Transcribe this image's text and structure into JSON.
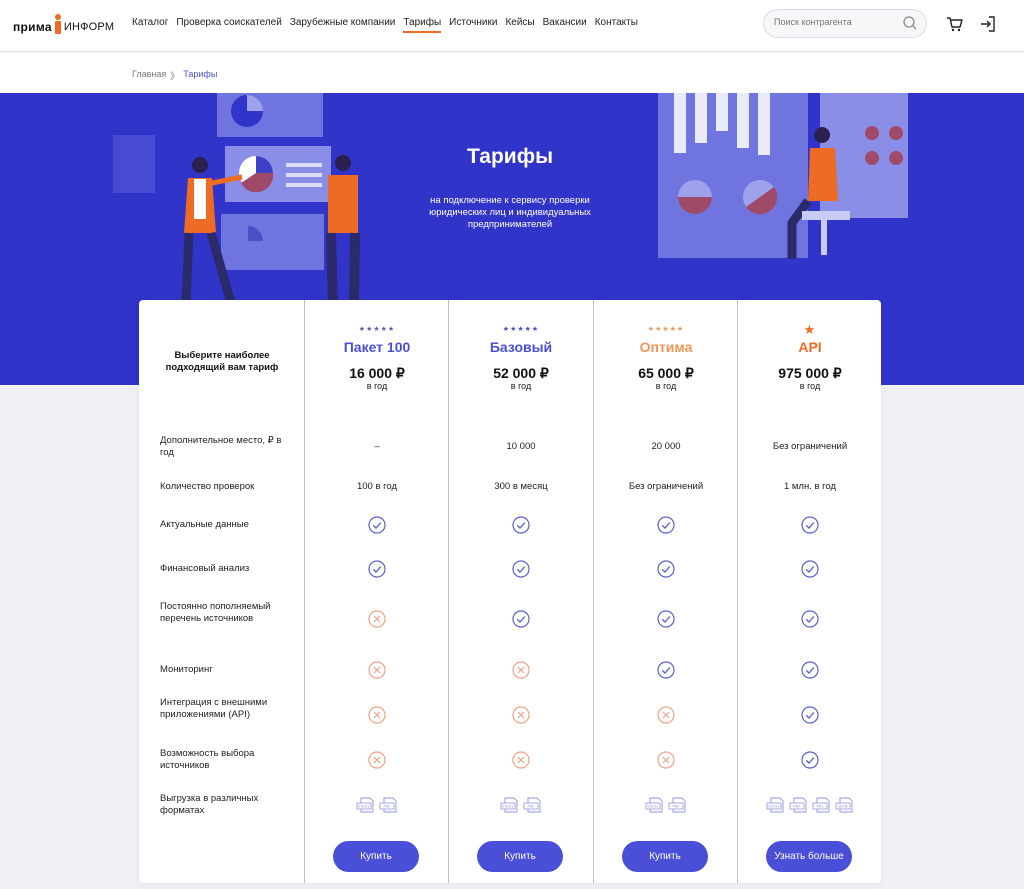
{
  "header": {
    "logo_bold": "прима",
    "logo_light": "ИНФОРМ",
    "nav": [
      "Каталог",
      "Проверка соискателей",
      "Зарубежные компании",
      "Тарифы",
      "Источники",
      "Кейсы",
      "Вакансии",
      "Контакты"
    ],
    "search_placeholder": "Поиск контрагента"
  },
  "breadcrumb": {
    "home": "Главная",
    "sep": "》",
    "current": "Тарифы"
  },
  "hero": {
    "title": "Тарифы",
    "subtitle": "на подключение к сервису проверки юридических лиц и индивидуальных предпринимателей"
  },
  "pricing": {
    "choose_label": "Выберите наиболее подходящий вам тариф",
    "plans": [
      {
        "stars": "★★★★★",
        "name": "Пакет 100",
        "price": "16 000 ₽",
        "period": "в год",
        "name_color": "#4a4fd8",
        "star_color": "#5a5fb0",
        "button": "Купить"
      },
      {
        "stars": "★★★★★",
        "name": "Базовый",
        "price": "52 000 ₽",
        "period": "в год",
        "name_color": "#4a4fd8",
        "star_color": "#4a4fd8",
        "button": "Купить"
      },
      {
        "stars": "★★★★★",
        "name": "Оптима",
        "price": "65 000 ₽",
        "period": "в год",
        "name_color": "#f29456",
        "star_color": "#f29456",
        "button": "Купить"
      },
      {
        "stars": "★",
        "name": "API",
        "price": "975 000 ₽",
        "period": "в год",
        "name_color": "#ee6b24",
        "star_color": "#ee6b24",
        "button": "Узнать больше"
      }
    ],
    "rows": [
      {
        "label": "Дополнительное место, ₽ в год",
        "values": [
          "–",
          "10 000",
          "20 000",
          "Без ограничений"
        ]
      },
      {
        "label": "Количество проверок",
        "values": [
          "100 в год",
          "300 в месяц",
          "Без ограничений",
          "1 млн. в год"
        ]
      },
      {
        "label": "Актуальные данные",
        "checks": [
          true,
          true,
          true,
          true
        ]
      },
      {
        "label": "Финансовый анализ",
        "checks": [
          true,
          true,
          true,
          true
        ]
      },
      {
        "label": "Постоянно пополняемый перечень источников",
        "checks": [
          false,
          true,
          true,
          true
        ]
      },
      {
        "label": "Мониторинг",
        "checks": [
          false,
          false,
          true,
          true
        ]
      },
      {
        "label": "Интеграция с внешними приложениями (API)",
        "checks": [
          false,
          false,
          false,
          true
        ]
      },
      {
        "label": "Возможность выбора источников",
        "checks": [
          false,
          false,
          false,
          true
        ]
      },
      {
        "label": "Выгрузка в различных форматах",
        "formats": [
          [
            "EXCEL",
            "PDF"
          ],
          [
            "EXCEL",
            "PDF"
          ],
          [
            "EXCEL",
            "PDF"
          ],
          [
            "EXCEL",
            "PDF",
            "XML",
            "JSON"
          ]
        ]
      }
    ]
  },
  "colors": {
    "accent": "#4a4fd8",
    "hero": "#3034c8",
    "orange": "#ee6b24",
    "check": "#5a5fd0",
    "cross": "#f3a185"
  }
}
